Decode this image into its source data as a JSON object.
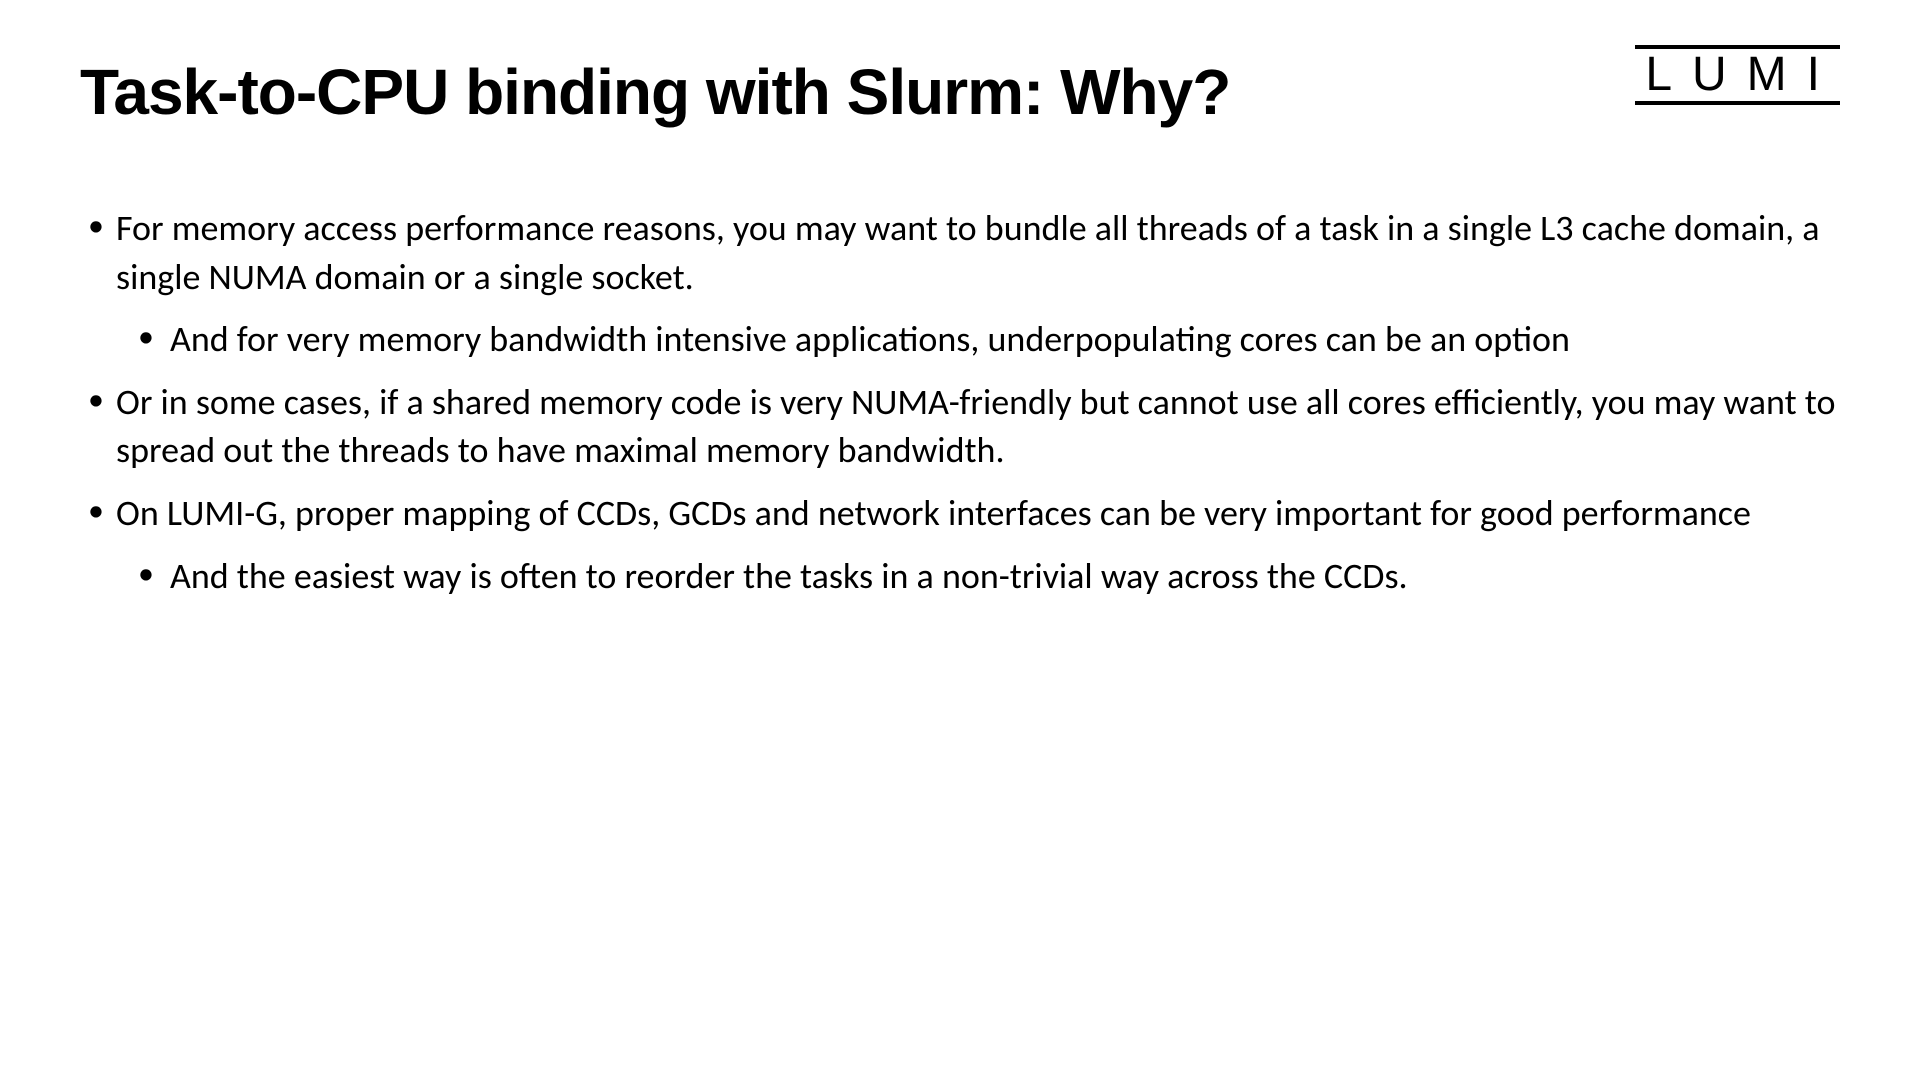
{
  "header": {
    "title": "Task-to-CPU binding with Slurm: Why?",
    "logo": "LUMI"
  },
  "bullets": [
    {
      "text": "For memory access performance reasons, you may want to bundle all threads of a task in a single L3 cache domain, a single NUMA domain or a single socket.",
      "sub": [
        "And for very memory bandwidth intensive applications, underpopulating cores can be an option"
      ]
    },
    {
      "text": "Or in some cases, if a shared memory code is very NUMA-friendly but cannot use all cores efficiently, you may want to spread out the threads to have maximal memory bandwidth.",
      "sub": []
    },
    {
      "text": "On LUMI-G, proper mapping of CCDs, GCDs and network interfaces can be very important for good performance",
      "sub": [
        "And the easiest way is often to reorder the tasks in a non-trivial way across the CCDs."
      ]
    }
  ]
}
